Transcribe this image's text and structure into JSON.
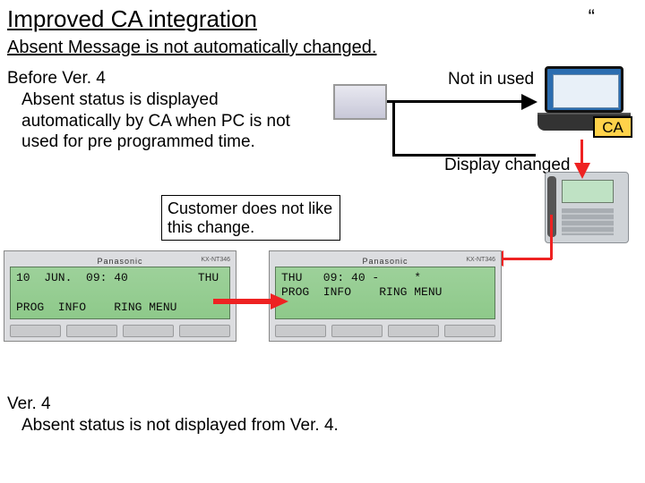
{
  "title": "Improved CA integration",
  "quote_mark": "“",
  "subtitle": "Absent Message is not automatically changed.",
  "before": {
    "heading": "Before Ver. 4",
    "body": "Absent status is displayed automatically by CA when PC is not used for pre programmed time."
  },
  "dislike_text": "Customer does not like this change.",
  "ver4": {
    "heading": "Ver. 4",
    "body": "Absent status is not displayed  from Ver. 4."
  },
  "diagram": {
    "not_in_used": "Not in used",
    "display_changed": "Display changed",
    "ca_label": "CA"
  },
  "panel_left": {
    "brand": "Panasonic",
    "model": "KX-NT346",
    "lcd_line1": "10  JUN.  09: 40          THU",
    "lcd_line2": " ",
    "lcd_line3": "PROG  INFO    RING MENU"
  },
  "panel_right": {
    "brand": "Panasonic",
    "model": "KX-NT346",
    "lcd_line1": "THU   09: 40 -     *",
    "lcd_line2": "PROG  INFO    RING MENU",
    "lcd_line3": " "
  }
}
